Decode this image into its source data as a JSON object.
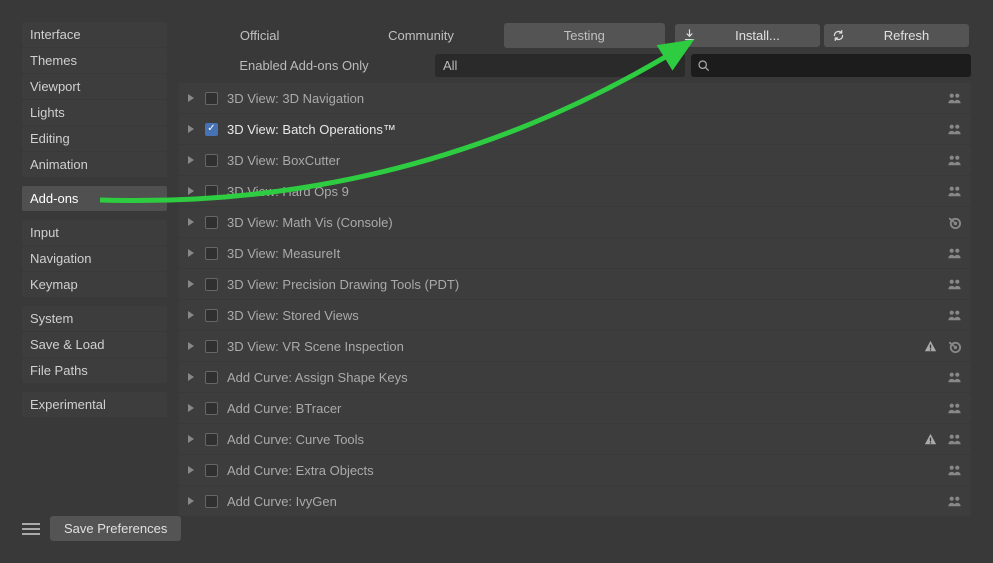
{
  "sidebar": {
    "groups": [
      [
        "Interface",
        "Themes",
        "Viewport",
        "Lights",
        "Editing",
        "Animation"
      ],
      [
        "Add-ons"
      ],
      [
        "Input",
        "Navigation",
        "Keymap"
      ],
      [
        "System",
        "Save & Load",
        "File Paths"
      ],
      [
        "Experimental"
      ]
    ],
    "active": "Add-ons"
  },
  "toolbar": {
    "tabs": [
      "Official",
      "Community",
      "Testing"
    ],
    "depressed": "Testing",
    "install_label": "Install...",
    "refresh_label": "Refresh"
  },
  "filter": {
    "enabled_label": "Enabled Add-ons Only",
    "category": "All",
    "search_placeholder": ""
  },
  "addons": [
    {
      "name": "3D View: 3D Navigation",
      "checked": false,
      "icons": [
        "community"
      ]
    },
    {
      "name": "3D View: Batch Operations™",
      "checked": true,
      "icons": [
        "community"
      ]
    },
    {
      "name": "3D View: BoxCutter",
      "checked": false,
      "icons": [
        "community"
      ]
    },
    {
      "name": "3D View: Hard Ops 9",
      "checked": false,
      "icons": [
        "community"
      ]
    },
    {
      "name": "3D View: Math Vis (Console)",
      "checked": false,
      "icons": [
        "blender"
      ]
    },
    {
      "name": "3D View: MeasureIt",
      "checked": false,
      "icons": [
        "community"
      ]
    },
    {
      "name": "3D View: Precision Drawing Tools (PDT)",
      "checked": false,
      "icons": [
        "community"
      ]
    },
    {
      "name": "3D View: Stored Views",
      "checked": false,
      "icons": [
        "community"
      ]
    },
    {
      "name": "3D View: VR Scene Inspection",
      "checked": false,
      "icons": [
        "warning",
        "blender"
      ]
    },
    {
      "name": "Add Curve: Assign Shape Keys",
      "checked": false,
      "icons": [
        "community"
      ]
    },
    {
      "name": "Add Curve: BTracer",
      "checked": false,
      "icons": [
        "community"
      ]
    },
    {
      "name": "Add Curve: Curve Tools",
      "checked": false,
      "icons": [
        "warning",
        "community"
      ]
    },
    {
      "name": "Add Curve: Extra Objects",
      "checked": false,
      "icons": [
        "community"
      ]
    },
    {
      "name": "Add Curve: IvyGen",
      "checked": false,
      "icons": [
        "community"
      ]
    }
  ],
  "footer": {
    "save_label": "Save Preferences"
  },
  "colors": {
    "arrow": "#2ecc40"
  }
}
